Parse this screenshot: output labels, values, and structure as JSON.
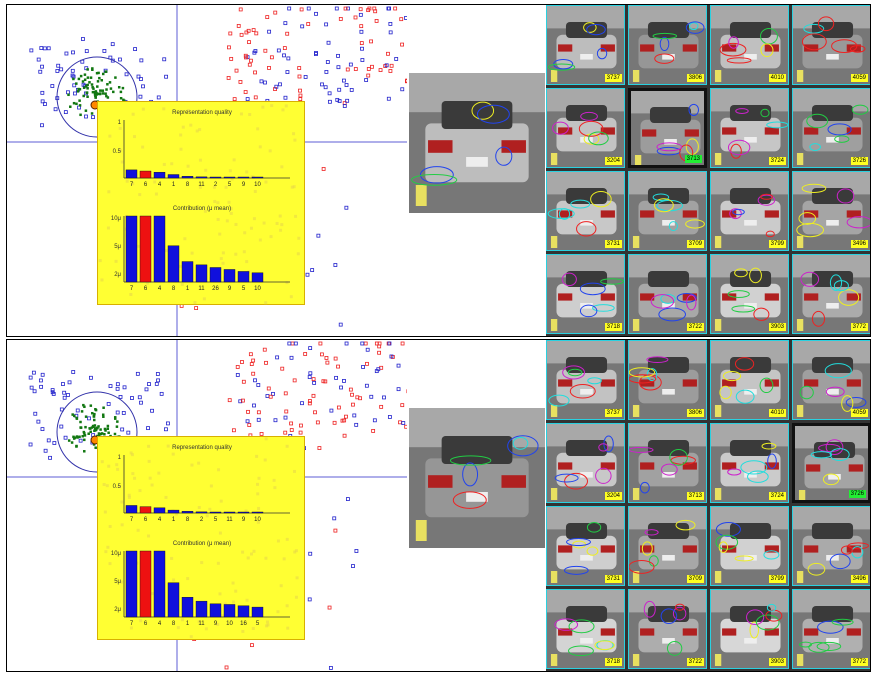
{
  "panels": [
    {
      "name": "top",
      "quality": {
        "title": "Representation quality",
        "y_ticks": [
          "1",
          "0.5"
        ],
        "x_labels": [
          "7",
          "6",
          "4",
          "1",
          "8",
          "11",
          "2",
          "5",
          "9",
          "10"
        ],
        "values": [
          0.14,
          0.12,
          0.1,
          0.06,
          0.03,
          0.02,
          0.01,
          0.01,
          0.01,
          0.01
        ]
      },
      "contribution": {
        "title": "Contribution (μ mean)",
        "y_ticks": [
          "10μ",
          "5μ",
          "2μ"
        ],
        "x_labels": [
          "7",
          "6",
          "4",
          "8",
          "1",
          "11",
          "26",
          "9",
          "5",
          "10"
        ],
        "values": [
          10,
          10,
          10,
          5.5,
          3.1,
          2.6,
          2.2,
          1.9,
          1.6,
          1.4
        ]
      },
      "selected_index": 5,
      "grid": [
        "3737",
        "3806",
        "4010",
        "4059",
        "3204",
        "3713",
        "3724",
        "3726",
        "3731",
        "3709",
        "3799",
        "3496",
        "3718",
        "3722",
        "3903",
        "3772"
      ]
    },
    {
      "name": "bottom",
      "quality": {
        "title": "Representation quality",
        "y_ticks": [
          "1",
          "0.5"
        ],
        "x_labels": [
          "7",
          "6",
          "4",
          "1",
          "8",
          "2",
          "5",
          "11",
          "9",
          "10"
        ],
        "values": [
          0.13,
          0.11,
          0.09,
          0.05,
          0.03,
          0.02,
          0.01,
          0.01,
          0.01,
          0.01
        ]
      },
      "contribution": {
        "title": "Contribution (μ mean)",
        "y_ticks": [
          "10μ",
          "5μ",
          "2μ"
        ],
        "x_labels": [
          "7",
          "6",
          "4",
          "8",
          "1",
          "11",
          "9",
          "10",
          "16",
          "5"
        ],
        "values": [
          10,
          10,
          10,
          5.2,
          3.0,
          2.4,
          2.0,
          1.9,
          1.7,
          1.5
        ]
      },
      "selected_index": 7,
      "grid": [
        "3737",
        "3806",
        "4010",
        "4059",
        "3204",
        "3713",
        "3724",
        "3726",
        "3731",
        "3709",
        "3799",
        "3496",
        "3718",
        "3722",
        "3903",
        "3772"
      ]
    }
  ],
  "colors": {
    "axis": "#5c5cd6",
    "bar_blue": "#1010dd",
    "bar_red": "#ee1111",
    "box": "#ffff33",
    "grid_border": "#2ad1e0",
    "id_tag": "#ffff22",
    "id_selected": "#22ee33",
    "sample_red": "#ee2222",
    "sample_blue": "#2222cc",
    "sample_green": "#117711"
  }
}
